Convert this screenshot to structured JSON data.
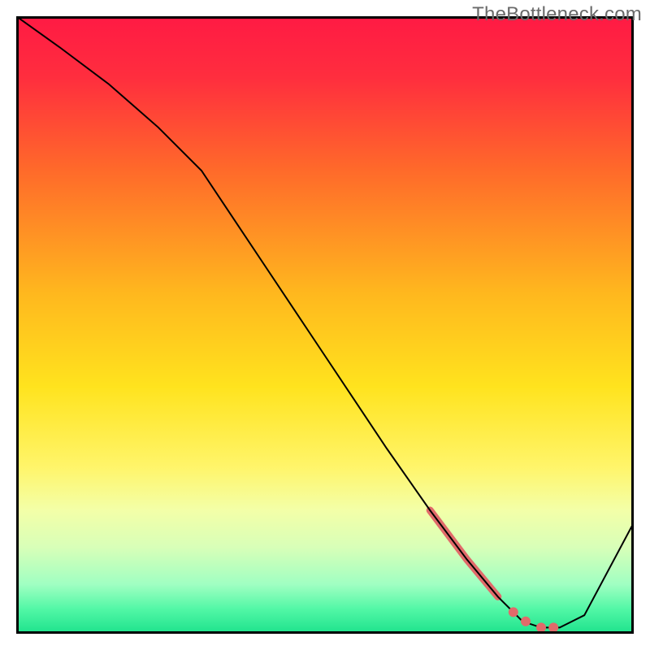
{
  "watermark": "TheBottleneck.com",
  "chart_data": {
    "type": "line",
    "title": "",
    "xlabel": "",
    "ylabel": "",
    "xlim": [
      0,
      100
    ],
    "ylim": [
      0,
      100
    ],
    "grid": false,
    "legend": false,
    "gradient_stops": [
      {
        "offset": 0,
        "color": "#ff1a44"
      },
      {
        "offset": 0.1,
        "color": "#ff2e3e"
      },
      {
        "offset": 0.25,
        "color": "#ff6a2a"
      },
      {
        "offset": 0.45,
        "color": "#ffb81e"
      },
      {
        "offset": 0.6,
        "color": "#ffe31e"
      },
      {
        "offset": 0.73,
        "color": "#fff56a"
      },
      {
        "offset": 0.8,
        "color": "#f3ffa8"
      },
      {
        "offset": 0.86,
        "color": "#d8ffb8"
      },
      {
        "offset": 0.92,
        "color": "#a0ffc2"
      },
      {
        "offset": 0.96,
        "color": "#52f7a6"
      },
      {
        "offset": 1.0,
        "color": "#1de28c"
      }
    ],
    "series": [
      {
        "name": "curve",
        "color": "#000000",
        "width": 2,
        "x": [
          0,
          7,
          15,
          23,
          30,
          40,
          50,
          60,
          67,
          73,
          78,
          82,
          85,
          88,
          92,
          100
        ],
        "y": [
          100,
          95,
          89,
          82,
          75,
          60,
          45,
          30,
          20,
          12,
          6,
          2,
          1,
          1,
          3,
          18
        ]
      }
    ],
    "highlight_segment": {
      "name": "highlight-band",
      "color": "#e16a6a",
      "width": 9,
      "x": [
        67,
        73,
        78
      ],
      "y": [
        20,
        12,
        6
      ]
    },
    "highlight_points": {
      "name": "highlight-dots",
      "color": "#e16a6a",
      "radius": 6,
      "points": [
        {
          "x": 80.5,
          "y": 3.5
        },
        {
          "x": 82.5,
          "y": 2.0
        },
        {
          "x": 85.0,
          "y": 1.0
        },
        {
          "x": 87.0,
          "y": 1.0
        }
      ]
    }
  }
}
